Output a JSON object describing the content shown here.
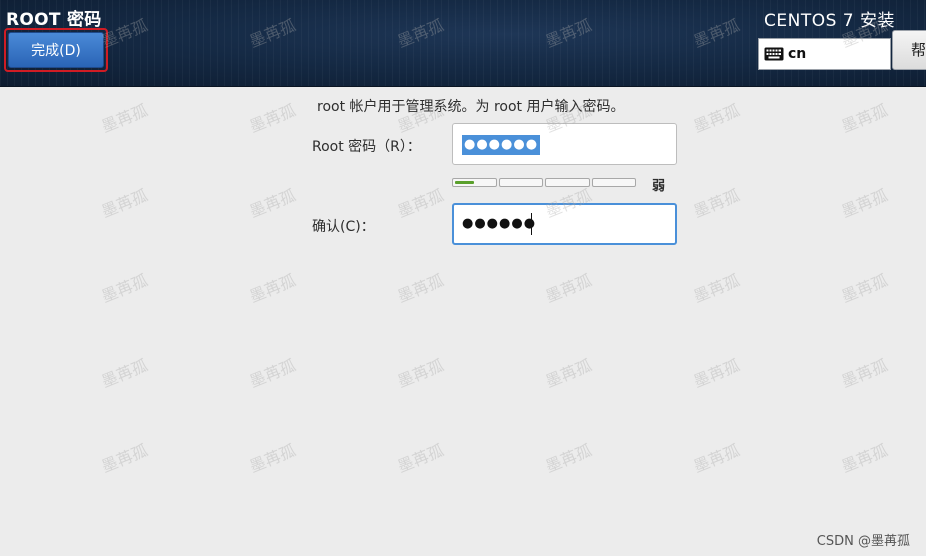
{
  "header": {
    "title": "ROOT 密码",
    "done_button_label": "完成(D)",
    "install_title": "CENTOS 7 安装",
    "keyboard_layout": "cn",
    "help_button_label": "帮",
    "accent_color": "#2a64b6",
    "highlight_border_color": "#d01c24"
  },
  "main": {
    "intro": "root 帐户用于管理系统。为 root 用户输入密码。",
    "root_password": {
      "label": "Root 密码（R）：",
      "masked_value": "●●●●●●"
    },
    "strength": {
      "segments": 4,
      "filled_fraction_of_first_segment": 0.5,
      "label": "弱"
    },
    "confirm": {
      "label": "确认(C)：",
      "masked_value": "●●●●●●"
    }
  },
  "watermark": {
    "text": "墨苒孤",
    "credit": "CSDN @墨苒孤"
  },
  "icons": [
    "keyboard-icon"
  ]
}
